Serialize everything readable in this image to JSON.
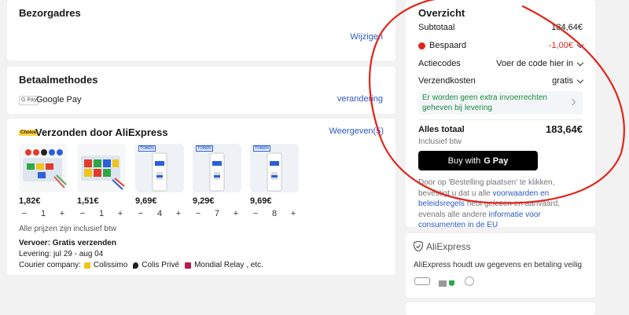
{
  "delivery": {
    "title": "Bezorgadres",
    "edit_link": "Wijzigen"
  },
  "payment": {
    "title": "Betaalmethodes",
    "method_icon": "G Pay",
    "method": "Google Pay",
    "change_link": "verandering"
  },
  "shipping": {
    "badge": "Choice",
    "title": "Verzonden door AliExpress",
    "view_link": "Weergeven(5)",
    "items": [
      {
        "price": "1,82€",
        "qty": "1"
      },
      {
        "price": "1,51€",
        "qty": "1"
      },
      {
        "price": "9,69€",
        "qty": "4"
      },
      {
        "price": "9,29€",
        "qty": "7"
      },
      {
        "price": "9,69€",
        "qty": "8"
      }
    ],
    "brand_label": "TOMZN",
    "minus": "−",
    "plus": "+",
    "tax_note": "Alle prijzen zijn inclusief btw",
    "carrier": "Vervoer: Gratis verzenden",
    "delivery_window": "Levering: jul 29 - aug 04",
    "courier_label": "Courier company:",
    "couriers": [
      "Colissimo",
      "Colis Privé",
      "Mondial Relay , etc."
    ]
  },
  "summary": {
    "title": "Overzicht",
    "subtotal_label": "Subtotaal",
    "subtotal_value": "184,64€",
    "saved_label": "Bespaard",
    "saved_value": "-1,00€",
    "codes_label": "Actiecodes",
    "codes_value": "Voer de code hier in",
    "shipping_label": "Verzendkosten",
    "shipping_value": "gratis",
    "notice": "Er worden geen extra invoerrechten geheven bij levering",
    "total_label": "Alles totaal",
    "total_value": "183,64€",
    "total_note": "Inclusief btw",
    "buy_label": "Buy with",
    "buy_brand": "G Pay",
    "legal_1": "Door op 'Bestelling plaatsen' te klikken, bevestigt u dat u alle ",
    "legal_link_1": "voorwaarden en beleidsregels",
    "legal_2": " hebt gelezen en aanvaard, evenals alle andere ",
    "legal_link_2": "informatie voor consumenten in de EU"
  },
  "trust": {
    "logo": "AliExpress",
    "text": "AliExpress houdt uw gegevens en betaling veilig"
  },
  "colors": {
    "link": "#2b59c3",
    "sale": "#e1251b",
    "notice_green": "#1a8a3a",
    "annotation": "#e1251b"
  }
}
